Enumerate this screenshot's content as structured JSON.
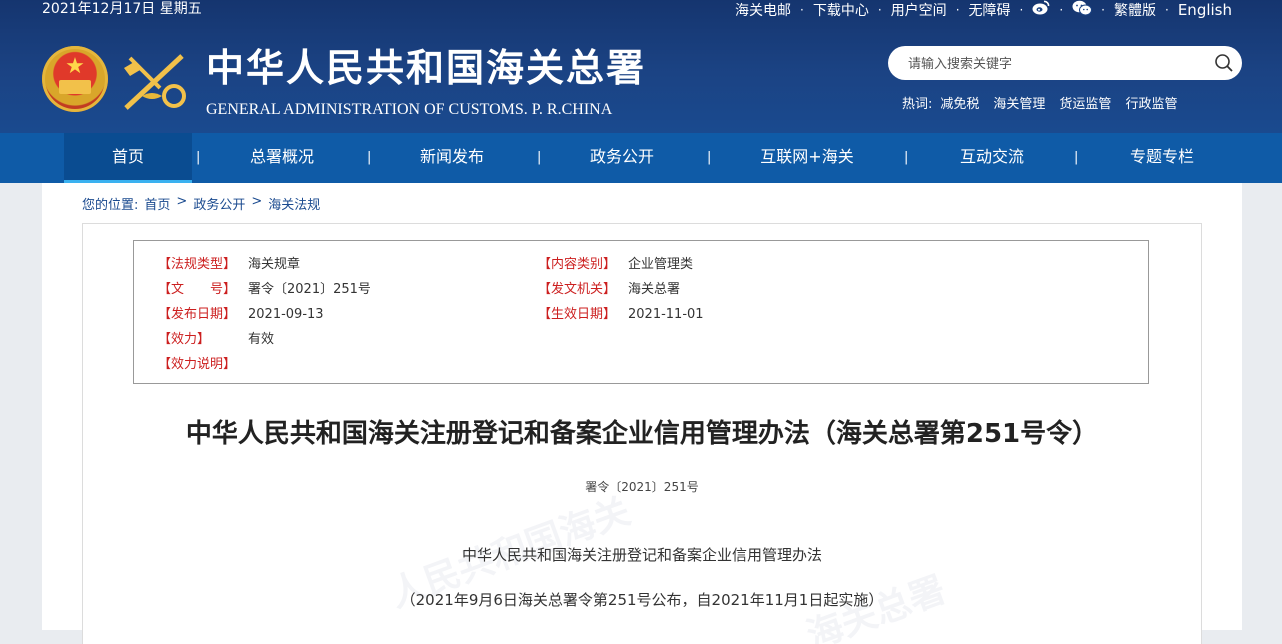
{
  "header": {
    "date": "2021年12月17日 星期五",
    "toplinks": [
      "海关电邮",
      "下载中心",
      "用户空间",
      "无障碍"
    ],
    "traditional": "繁體版",
    "english": "English",
    "title": "中华人民共和国海关总署",
    "subtitle": "GENERAL ADMINISTRATION OF CUSTOMS. P. R.CHINA",
    "search_placeholder": "请输入搜索关键字",
    "hotwords_label": "热词:",
    "hotwords": [
      "减免税",
      "海关管理",
      "货运监管",
      "行政监管"
    ]
  },
  "nav": {
    "items": [
      "首页",
      "总署概况",
      "新闻发布",
      "政务公开",
      "互联网+海关",
      "互动交流",
      "专题专栏"
    ],
    "separator": "|"
  },
  "breadcrumb": {
    "prefix": "您的位置:",
    "items": [
      "首页",
      "政务公开",
      "海关法规"
    ],
    "separator": ">"
  },
  "meta": {
    "fields": [
      {
        "key": "【法规类型】",
        "value": "海关规章"
      },
      {
        "key": "【内容类别】",
        "value": "企业管理类"
      },
      {
        "key": "【文　　号】",
        "value": "署令〔2021〕251号"
      },
      {
        "key": "【发文机关】",
        "value": "海关总署"
      },
      {
        "key": "【发布日期】",
        "value": "2021-09-13"
      },
      {
        "key": "【生效日期】",
        "value": "2021-11-01"
      },
      {
        "key": "【效力】",
        "value": "有效"
      },
      {
        "key": "【效力说明】",
        "value": ""
      }
    ]
  },
  "article": {
    "title": "中华人民共和国海关注册登记和备案企业信用管理办法（海关总署第251号令）",
    "number": "署令〔2021〕251号",
    "subtitle": "中华人民共和国海关注册登记和备案企业信用管理办法",
    "note": "（2021年9月6日海关总署令第251号公布，自2021年11月1日起实施）"
  },
  "colors": {
    "header_bg": "#1b4384",
    "nav_bg": "#0f5ba7",
    "meta_key": "#cc1f1f",
    "breadcrumb": "#1a4a8f"
  }
}
